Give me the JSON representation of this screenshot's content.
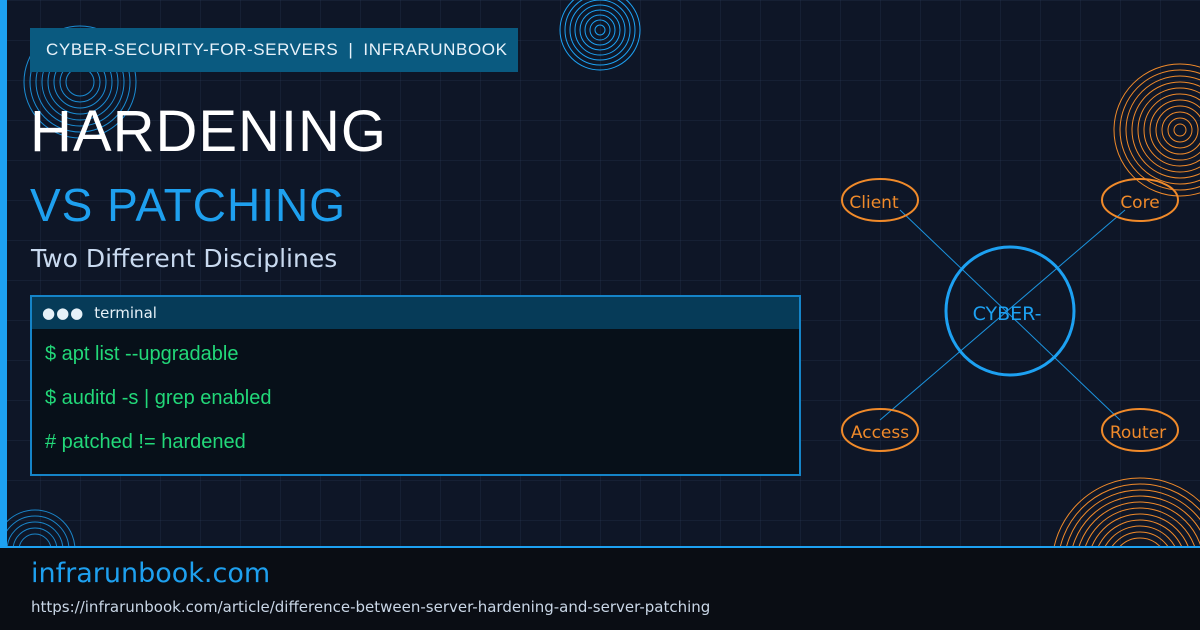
{
  "header": {
    "category": "CYBER-SECURITY-FOR-SERVERS",
    "separator": "|",
    "site": "INFRARUNBOOK"
  },
  "title": {
    "line1": "HARDENING",
    "line2": "VS PATCHING",
    "subtitle": "Two Different Disciplines"
  },
  "terminal": {
    "dots": "●●●",
    "label": "terminal",
    "lines": [
      "$ apt list --upgradable",
      "$ auditd -s | grep enabled",
      "# patched != hardened"
    ]
  },
  "diagram": {
    "center": "CYBER-",
    "nodes": [
      "Client",
      "Core",
      "Access",
      "Router"
    ]
  },
  "footer": {
    "domain": "infrarunbook.com",
    "url": "https://infrarunbook.com/article/difference-between-server-hardening-and-server-patching"
  },
  "colors": {
    "accent": "#1da1f2",
    "orange": "#f08a2a",
    "terminal_green": "#22d879",
    "background": "#0e1627"
  }
}
